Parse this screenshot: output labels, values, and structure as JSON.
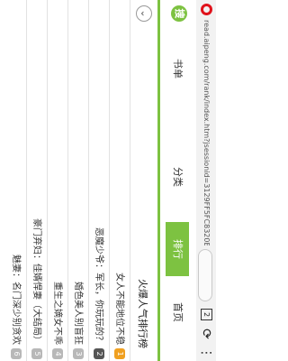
{
  "browser": {
    "url": "read.aipeng.com/rank/index.htm?jsessionid=3129FF5FC8320E",
    "tab_count": "2",
    "reload_icon": "reload-icon",
    "more_icon": "more-vertical-icon"
  },
  "nav": {
    "logo": "搜",
    "items": [
      "书单",
      "分类",
      "排行",
      "首页"
    ]
  },
  "ranking": {
    "title": "火爆人气排行榜",
    "chevron": "chevron-down-icon",
    "items": [
      {
        "rank": "1",
        "title": "女人不能地位不稳"
      },
      {
        "rank": "2",
        "title": "恶魔少爷：军长，你玩玩的？"
      },
      {
        "rank": "3",
        "title": "婚色美人别盲狂"
      },
      {
        "rank": "4",
        "title": "重生之嫡女不乖"
      },
      {
        "rank": "5",
        "title": "豪门弃妇：佳婿悍妻（大结局）"
      },
      {
        "rank": "6",
        "title": "魅妻：名门深少别贪欢"
      }
    ],
    "colors": {
      "accent": "#7dc241",
      "rank_top": "#f0a020",
      "rank_second": "#555555",
      "rank_default": "#b8b8b8"
    }
  }
}
